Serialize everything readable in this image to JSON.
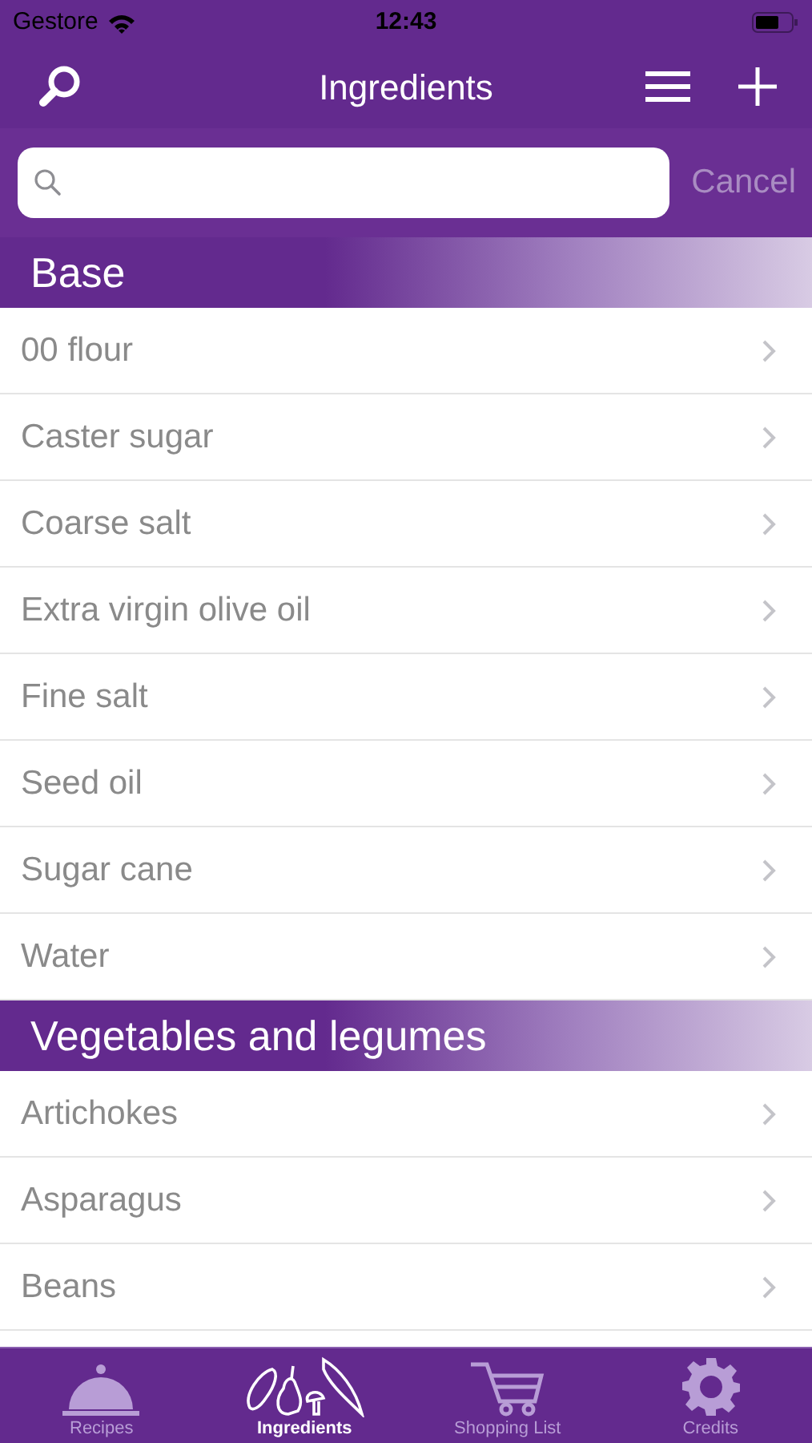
{
  "status_bar": {
    "carrier": "Gestore",
    "time": "12:43"
  },
  "nav_bar": {
    "title": "Ingredients"
  },
  "search": {
    "cancel": "Cancel"
  },
  "sections": [
    {
      "title": "Base",
      "items": [
        "00 flour",
        "Caster sugar",
        "Coarse salt",
        "Extra virgin olive oil",
        "Fine salt",
        "Seed oil",
        "Sugar cane",
        "Water"
      ]
    },
    {
      "title": "Vegetables and legumes",
      "items": [
        "Artichokes",
        "Asparagus",
        "Beans"
      ]
    }
  ],
  "tabs": [
    {
      "label": "Recipes",
      "kind": "cloche",
      "selected": false
    },
    {
      "label": "Ingredients",
      "kind": "produce",
      "selected": true
    },
    {
      "label": "Shopping List",
      "kind": "cart",
      "selected": false
    },
    {
      "label": "Credits",
      "kind": "gear",
      "selected": false
    }
  ]
}
